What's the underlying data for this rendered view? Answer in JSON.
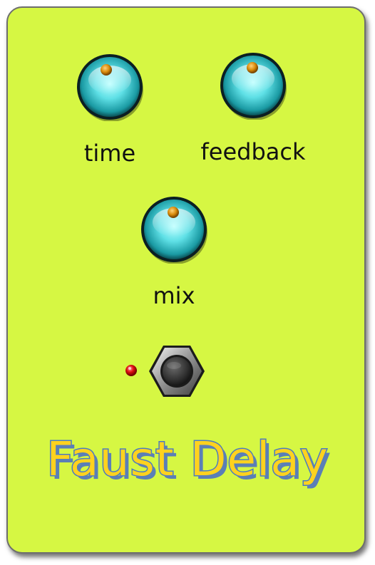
{
  "pedal": {
    "title": "Faust Delay",
    "background_color": "#d6f743",
    "title_fill_color": "#ffd21e",
    "title_outline_color": "#4a7bc2"
  },
  "knobs": [
    {
      "id": "time",
      "label": "time"
    },
    {
      "id": "feedback",
      "label": "feedback"
    },
    {
      "id": "mix",
      "label": "mix"
    }
  ],
  "knob_style": {
    "body_color": "#33c6cf",
    "indicator_color": "#d98a0a"
  },
  "led": {
    "color": "#e01010",
    "state": "on"
  },
  "footswitch": {
    "icon": "footswitch-icon"
  }
}
